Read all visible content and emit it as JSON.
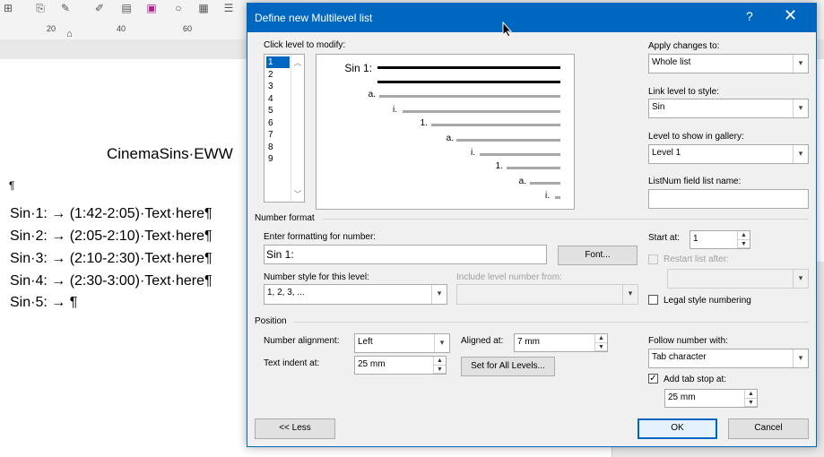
{
  "background_doc": {
    "ruler_labels": [
      "20",
      "40",
      "60"
    ],
    "heading": "CinemaSins·EWW",
    "pilcrow": "¶",
    "lines": [
      "Sin·1: → (1:42-2:05)·Text·here¶",
      "Sin·2: → (2:05-2:10)·Text·here¶",
      "Sin·3: → (2:10-2:30)·Text·here¶",
      "Sin·4: → (2:30-3:00)·Text·here¶",
      "Sin·5: → ¶"
    ]
  },
  "dialog": {
    "title": "Define new Multilevel list",
    "help": "?",
    "close": "✕",
    "click_level_label": "Click level to modify:",
    "levels": [
      "1",
      "2",
      "3",
      "4",
      "5",
      "6",
      "7",
      "8",
      "9"
    ],
    "selected_level": "1",
    "preview": {
      "labels": [
        "Sin 1:",
        "a.",
        "i.",
        "1.",
        "a.",
        "i.",
        "1.",
        "a.",
        "i."
      ]
    },
    "apply_changes_label": "Apply changes to:",
    "apply_changes_value": "Whole list",
    "link_level_label": "Link level to style:",
    "link_level_value": "Sin",
    "level_gallery_label": "Level to show in gallery:",
    "level_gallery_value": "Level 1",
    "listnum_label": "ListNum field list name:",
    "listnum_value": "",
    "number_format_section": "Number format",
    "enter_formatting_label": "Enter formatting for number:",
    "enter_formatting_value": "Sin 1:",
    "font_button": "Font...",
    "number_style_label": "Number style for this level:",
    "number_style_value": "1, 2, 3, ...",
    "include_level_label": "Include level number from:",
    "include_level_value": "",
    "start_at_label": "Start at:",
    "start_at_value": "1",
    "restart_list_label": "Restart list after:",
    "restart_list_value": "",
    "legal_style_label": "Legal style numbering",
    "position_section": "Position",
    "number_alignment_label": "Number alignment:",
    "number_alignment_value": "Left",
    "aligned_at_label": "Aligned at:",
    "aligned_at_value": "7 mm",
    "text_indent_label": "Text indent at:",
    "text_indent_value": "25 mm",
    "set_all_levels_button": "Set for All Levels...",
    "follow_number_label": "Follow number with:",
    "follow_number_value": "Tab character",
    "add_tab_stop_label": "Add tab stop at:",
    "add_tab_stop_checked": true,
    "tab_stop_value": "25 mm",
    "less_button": "<< Less",
    "ok_button": "OK",
    "cancel_button": "Cancel"
  },
  "colors": {
    "accent": "#0067c0",
    "dialog_bg": "#f0f0f0"
  }
}
